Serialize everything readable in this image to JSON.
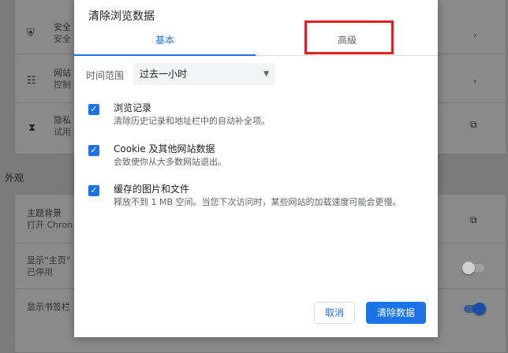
{
  "background": {
    "sections": {
      "appearance_heading": "外观"
    },
    "privacy_items": [
      {
        "label": "安全",
        "sublabel": "安全"
      },
      {
        "label": "网站",
        "sublabel": "控制"
      },
      {
        "label": "隐私",
        "sublabel": "试用"
      }
    ],
    "appearance_items": [
      {
        "label": "主题背景",
        "sublabel": "打开 Chron"
      },
      {
        "label": "显示“主页”",
        "sublabel": "已停用"
      },
      {
        "label": "显示书签栏",
        "sublabel": ""
      }
    ]
  },
  "dialog": {
    "title": "清除浏览数据",
    "tabs": [
      {
        "label": "基本",
        "active": true
      },
      {
        "label": "高级",
        "active": false
      }
    ],
    "time_range": {
      "label": "时间范围",
      "selected": "过去一小时"
    },
    "items": [
      {
        "title": "浏览记录",
        "description": "清除历史记录和地址栏中的自动补全项。",
        "checked": true
      },
      {
        "title": "Cookie 及其他网站数据",
        "description": "会致使你从大多数网站退出。",
        "checked": true
      },
      {
        "title": "缓存的图片和文件",
        "description": "释放不到 1 MB 空间。当您下次访问时，某些网站的加载速度可能会更慢。",
        "checked": true
      }
    ],
    "buttons": {
      "cancel": "取消",
      "clear": "清除数据"
    }
  },
  "colors": {
    "accent": "#1a73e8",
    "highlight": "#e02020"
  }
}
